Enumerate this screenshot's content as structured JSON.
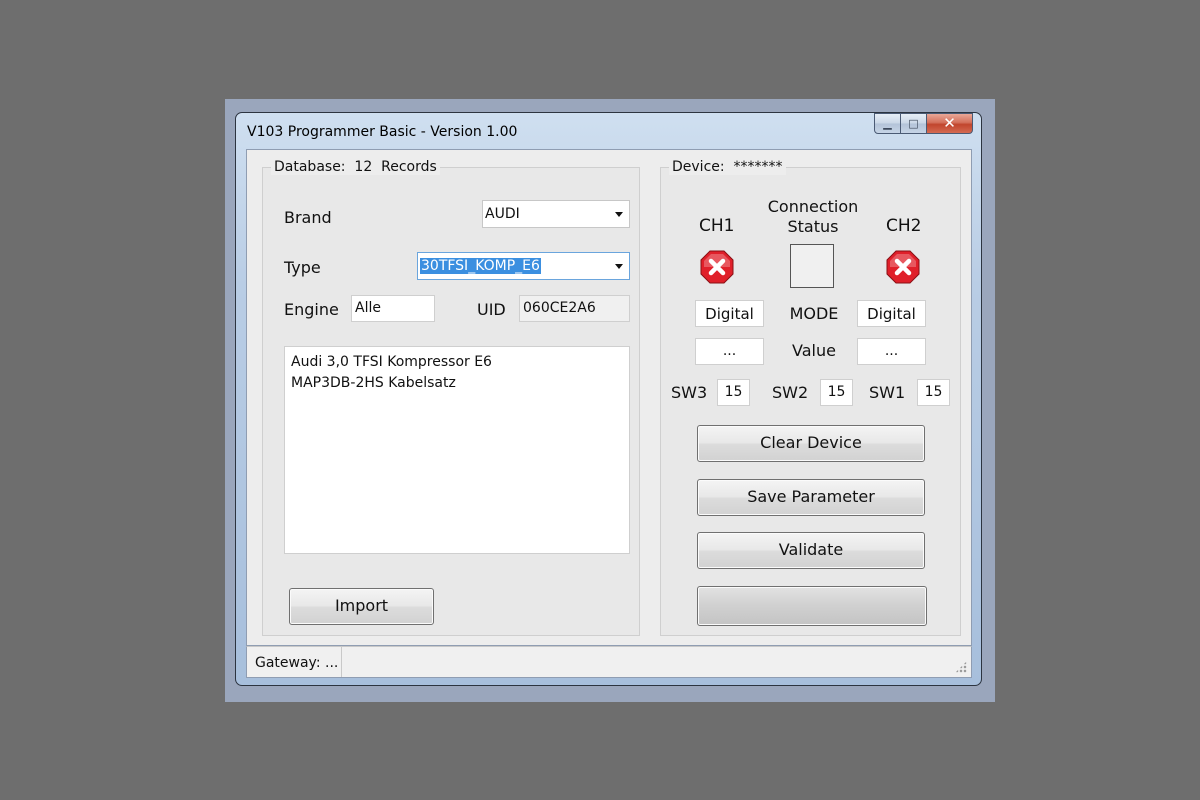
{
  "window": {
    "title": "V103 Programmer Basic - Version 1.00",
    "controls": {
      "minimize": "▁",
      "maximize": "□",
      "close": "✕"
    }
  },
  "database": {
    "legend": "Database:  12  Records",
    "brand_label": "Brand",
    "brand_value": "AUDI",
    "type_label": "Type",
    "type_value": "30TFSI_KOMP_E6",
    "engine_label": "Engine",
    "engine_value": "Alle",
    "uid_label": "UID",
    "uid_value": "060CE2A6",
    "description_lines": [
      "Audi 3,0 TFSI Kompressor E6",
      "MAP3DB-2HS Kabelsatz"
    ],
    "import_label": "Import"
  },
  "device": {
    "legend": "Device:  *******",
    "ch1_label": "CH1",
    "ch2_label": "CH2",
    "connection_label_1": "Connection",
    "connection_label_2": "Status",
    "ch1_status_icon": "error-x-icon",
    "ch2_status_icon": "error-x-icon",
    "mode_label": "MODE",
    "mode_ch1": "Digital",
    "mode_ch2": "Digital",
    "value_label": "Value",
    "value_ch1": "...",
    "value_ch2": "...",
    "sw3_label": "SW3",
    "sw3_value": "15",
    "sw2_label": "SW2",
    "sw2_value": "15",
    "sw1_label": "SW1",
    "sw1_value": "15",
    "clear_label": "Clear Device",
    "save_label": "Save Parameter",
    "validate_label": "Validate"
  },
  "statusbar": {
    "gateway": "Gateway: ..."
  },
  "colors": {
    "error_red": "#e0202a",
    "selection_blue": "#3b8fe0"
  }
}
